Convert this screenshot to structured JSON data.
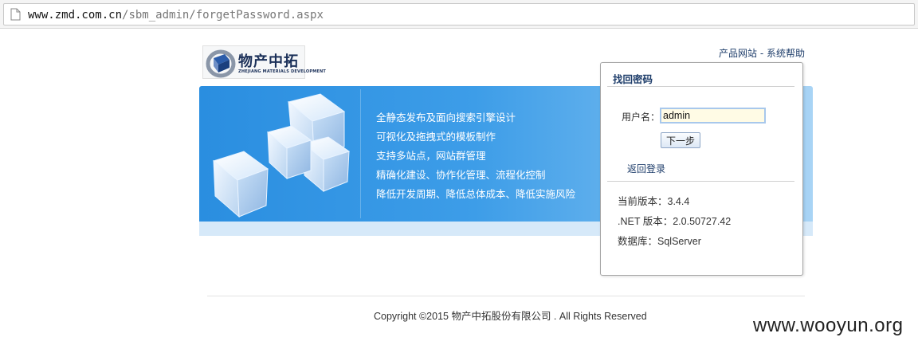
{
  "browser": {
    "url_domain": "www.zmd.com.cn",
    "url_path": "/sbm_admin/forgetPassword.aspx",
    "page_icon": "page-icon"
  },
  "logo": {
    "name_cn": "物产中拓",
    "name_en": "ZHEJIANG MATERIALS DEVELOPMENT"
  },
  "top_links": {
    "product_site": "产品网站",
    "separator": " - ",
    "help": "系统帮助"
  },
  "banner": {
    "features": [
      "全静态发布及面向搜索引擎设计",
      "可视化及拖拽式的模板制作",
      "支持多站点，网站群管理",
      "精确化建设、协作化管理、流程化控制",
      "降低开发周期、降低总体成本、降低实施风险"
    ],
    "colors": {
      "start": "#2a8ee0",
      "end": "#a9d4f5"
    }
  },
  "panel": {
    "title": "找回密码",
    "username_label": "用户名：",
    "username_value": "admin",
    "next_label": "下一步",
    "back_label": "返回登录",
    "info": [
      "当前版本：3.4.4",
      ".NET 版本：2.0.50727.42",
      "数据库：SqlServer"
    ]
  },
  "footer": {
    "copyright": "Copyright ©2015 物产中拓股份有限公司 . All Rights Reserved"
  },
  "watermark": "www.wooyun.org"
}
